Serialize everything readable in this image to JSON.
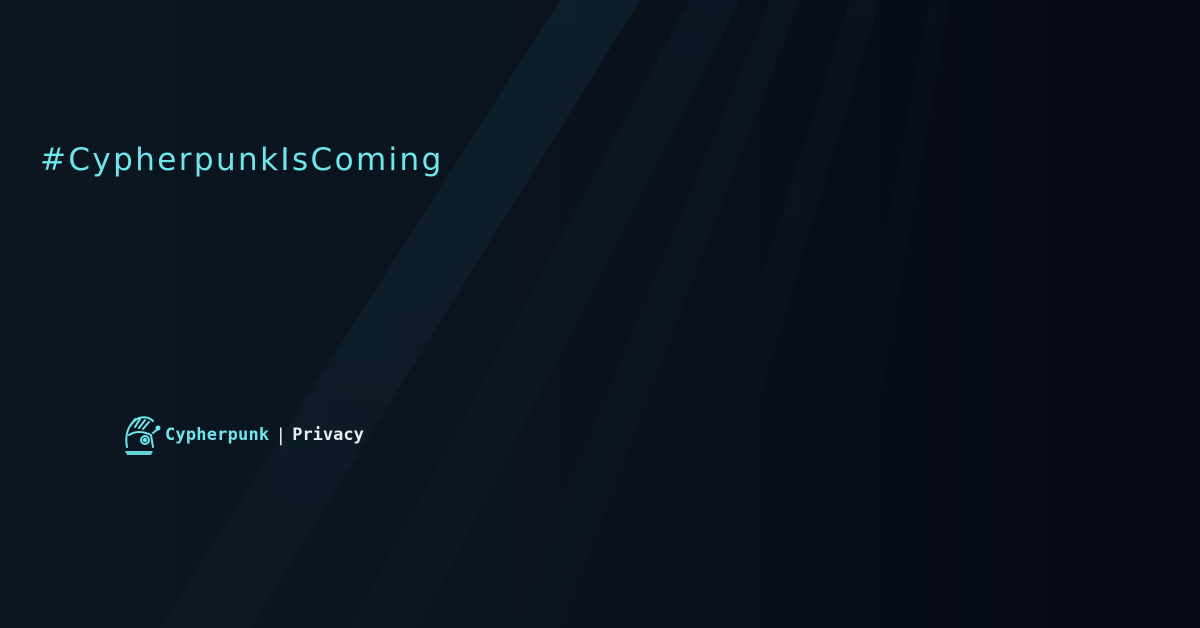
{
  "banner": {
    "hashtag": "#CypherpunkIsComing",
    "brand": {
      "logo_icon": "cypherpunk-helmet-logo-icon",
      "name": "Cypherpunk",
      "separator": "|",
      "tagline": "Privacy"
    }
  },
  "colors": {
    "accent": "#6fe6ec",
    "text_light": "#e8eef2",
    "background": "#0a141e"
  }
}
